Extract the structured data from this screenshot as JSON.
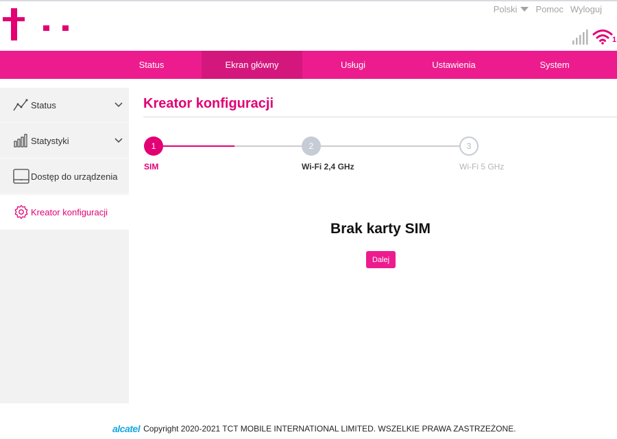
{
  "header": {
    "language": "Polski",
    "help": "Pomoc",
    "logout": "Wyloguj",
    "wifi_clients": "1"
  },
  "nav": {
    "items": [
      {
        "label": "Status"
      },
      {
        "label": "Ekran główny"
      },
      {
        "label": "Usługi"
      },
      {
        "label": "Ustawienia"
      },
      {
        "label": "System"
      }
    ],
    "active": "Ekran główny"
  },
  "sidebar": {
    "items": [
      {
        "label": "Status",
        "icon": "trend-line-icon"
      },
      {
        "label": "Statystyki",
        "icon": "bar-chart-icon"
      },
      {
        "label": "Dostęp do urządzenia",
        "icon": "device-icon"
      },
      {
        "label": "Kreator konfiguracji",
        "icon": "gear-icon"
      }
    ],
    "active": "Kreator konfiguracji"
  },
  "main": {
    "title": "Kreator konfiguracji",
    "steps": [
      {
        "number": "1",
        "label": "SIM"
      },
      {
        "number": "2",
        "label": "Wi-Fi 2,4 GHz"
      },
      {
        "number": "3",
        "label": "Wi-Fi 5 GHz"
      }
    ],
    "message": "Brak karty SIM",
    "next_button": "Dalej"
  },
  "footer": {
    "brand": "alcatel",
    "copyright": "Copyright 2020-2021 TCT MOBILE INTERNATIONAL LIMITED. WSZELKIE PRAWA ZASTRZEŻONE."
  },
  "colors": {
    "brand": "#e20074",
    "nav_bg": "#ec1c8e",
    "nav_active": "#d4177d",
    "sidebar_bg": "#f2f2f2",
    "step_inactive": "#c5ccd6",
    "footer_brand": "#1aa7e0"
  }
}
